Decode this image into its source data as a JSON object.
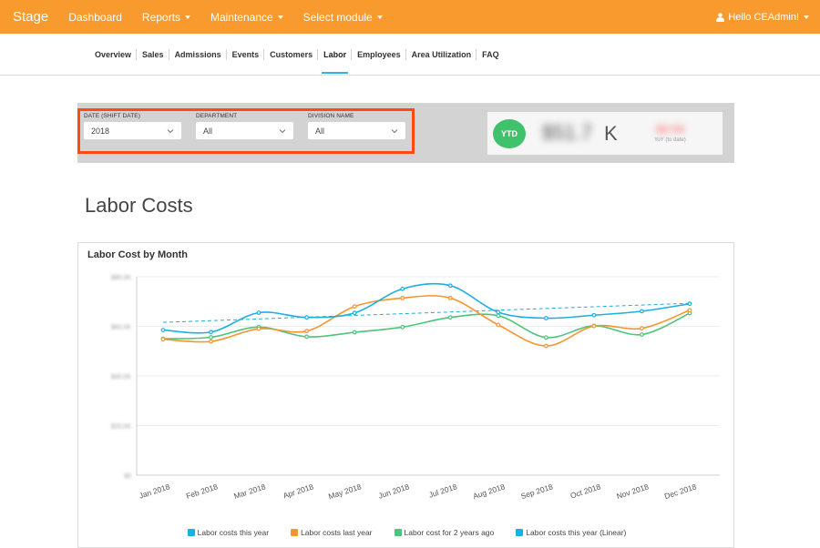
{
  "navbar": {
    "brand": "Stage",
    "items": [
      {
        "label": "Dashboard",
        "caret": false
      },
      {
        "label": "Reports",
        "caret": true
      },
      {
        "label": "Maintenance",
        "caret": true
      },
      {
        "label": "Select module",
        "caret": true
      }
    ],
    "user_label": "Hello CEAdmin!",
    "icon": "user-icon"
  },
  "tabs": [
    "Overview",
    "Sales",
    "Admissions",
    "Events",
    "Customers",
    "Labor",
    "Employees",
    "Area Utilization",
    "FAQ"
  ],
  "active_tab": "Labor",
  "filters": {
    "date": {
      "label": "DATE (SHIFT DATE)",
      "value": "2018"
    },
    "department": {
      "label": "DEPARTMENT",
      "value": "All"
    },
    "division": {
      "label": "DIVISION NAME",
      "value": "All"
    }
  },
  "ytd": {
    "badge": "YTD",
    "value": "$51.7",
    "suffix": "K",
    "yoy_value": "-$3.5K",
    "yoy_label": "YoY (to date)"
  },
  "page_title": "Labor Costs",
  "colors": {
    "navbar": "#f89a2e",
    "accent": "#31b4e4",
    "this_year": "#1eaee0",
    "last_year": "#f7942e",
    "two_years": "#4cc47a",
    "linear": "#1eaee0",
    "highlight": "#ff4a14"
  },
  "chart_data": {
    "type": "line",
    "title": "Labor Cost by Month",
    "categories": [
      "Jan 2018",
      "Feb 2018",
      "Mar 2018",
      "Apr 2018",
      "May 2018",
      "Jun 2018",
      "Jul 2018",
      "Aug 2018",
      "Sep 2018",
      "Oct 2018",
      "Nov 2018",
      "Dec 2018"
    ],
    "y_ticks": [
      "$80.0K",
      "$60.0K",
      "$40.0K",
      "$20.0K",
      "$0"
    ],
    "ylim": [
      0,
      80
    ],
    "grid": true,
    "legend": "bottom",
    "series": [
      {
        "name": "Labor costs this year",
        "values": [
          58.5,
          57.7,
          65.5,
          63.6,
          65.4,
          75.1,
          76.4,
          65.7,
          63.3,
          64.5,
          66.1,
          69.1
        ]
      },
      {
        "name": "Labor costs last year",
        "values": [
          54.8,
          53.9,
          59.0,
          58.1,
          68.0,
          71.4,
          71.4,
          60.6,
          52.1,
          60.1,
          59.2,
          66.5
        ]
      },
      {
        "name": "Labor cost for 2 years ago",
        "values": [
          55.0,
          55.6,
          59.7,
          55.8,
          57.6,
          59.7,
          63.6,
          64.3,
          55.5,
          60.2,
          56.7,
          65.3
        ]
      },
      {
        "name": "Labor costs this year (Linear)",
        "values": [
          61.6,
          62.3,
          63.0,
          63.7,
          64.4,
          65.1,
          65.8,
          66.5,
          67.2,
          67.9,
          68.6,
          69.3
        ]
      }
    ]
  }
}
